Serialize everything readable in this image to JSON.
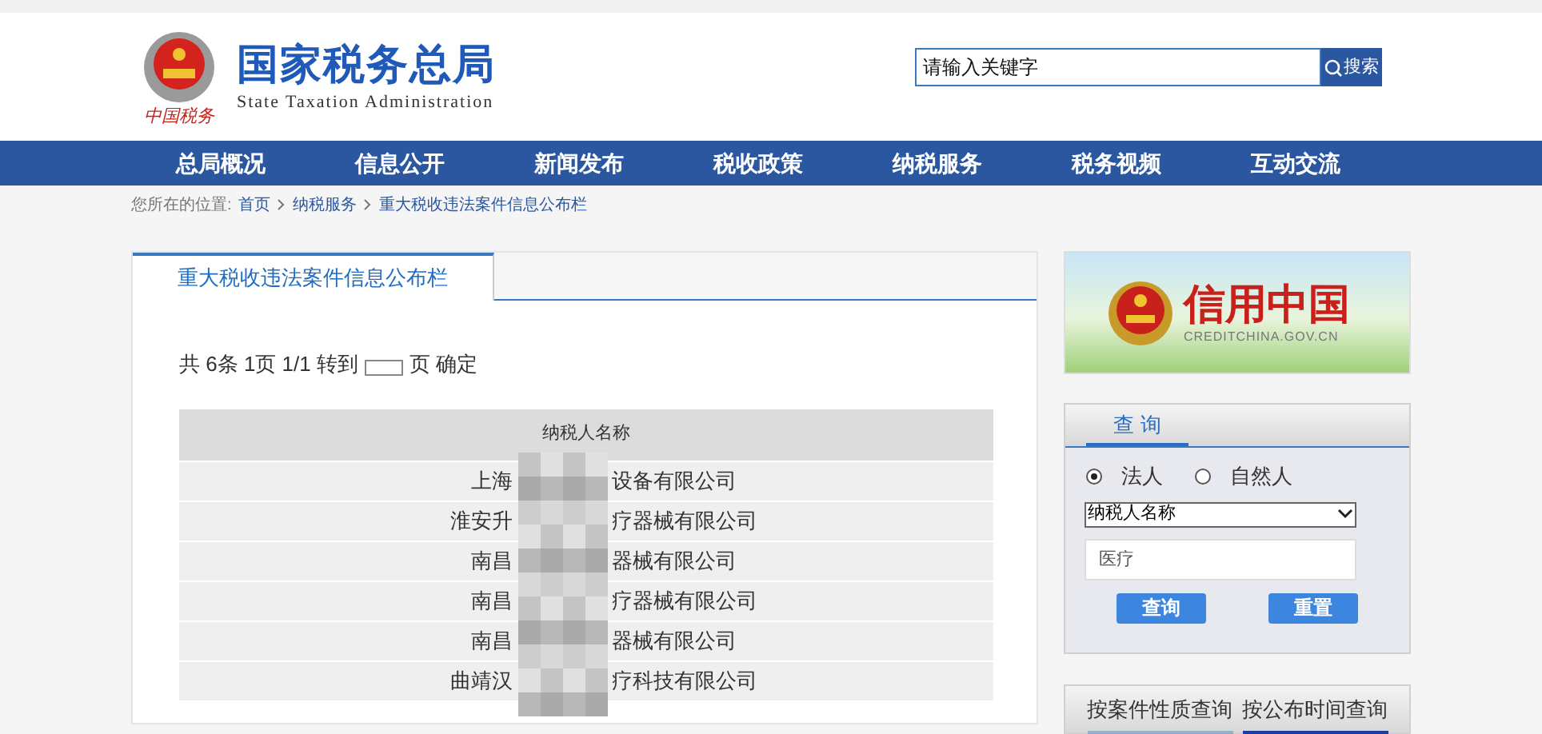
{
  "header": {
    "title": "国家税务总局",
    "subtitle": "State Taxation Administration",
    "seal_text": "中国税务",
    "search": {
      "placeholder": "请输入关键字",
      "button": "搜索"
    }
  },
  "nav": [
    "总局概况",
    "信息公开",
    "新闻发布",
    "税收政策",
    "纳税服务",
    "税务视频",
    "互动交流"
  ],
  "breadcrumb": {
    "label": "您所在的位置:",
    "items": [
      "首页",
      "纳税服务",
      "重大税收违法案件信息公布栏"
    ]
  },
  "main": {
    "tabs": [
      {
        "label": "重大税收违法案件信息公布栏",
        "selected": true
      }
    ],
    "pager": {
      "before": "共 6条 1页 1/1 转到",
      "after": "页 确定"
    },
    "table": {
      "columns": [
        "纳税人名称"
      ],
      "rows": [
        {
          "start": "上海",
          "end": "设备有限公司"
        },
        {
          "start": "淮安升",
          "end": "疗器械有限公司"
        },
        {
          "start": "南昌",
          "end": "器械有限公司"
        },
        {
          "start": "南昌",
          "end": "疗器械有限公司"
        },
        {
          "start": "南昌",
          "end": "器械有限公司"
        },
        {
          "start": "曲靖汉",
          "end": "疗科技有限公司"
        }
      ]
    }
  },
  "banner": {
    "title": "信用中国",
    "url": "CREDITCHINA.GOV.CN"
  },
  "query": {
    "tab": "查 询",
    "radios": [
      {
        "label": "法人",
        "selected": true
      },
      {
        "label": "自然人",
        "selected": false
      }
    ],
    "select": "纳税人名称",
    "input": "医疗",
    "buttons": [
      "查询",
      "重置"
    ]
  },
  "bottom_tabs": [
    {
      "label": "按案件性质查询",
      "selected": false
    },
    {
      "label": "按公布时间查询",
      "selected": true
    }
  ]
}
